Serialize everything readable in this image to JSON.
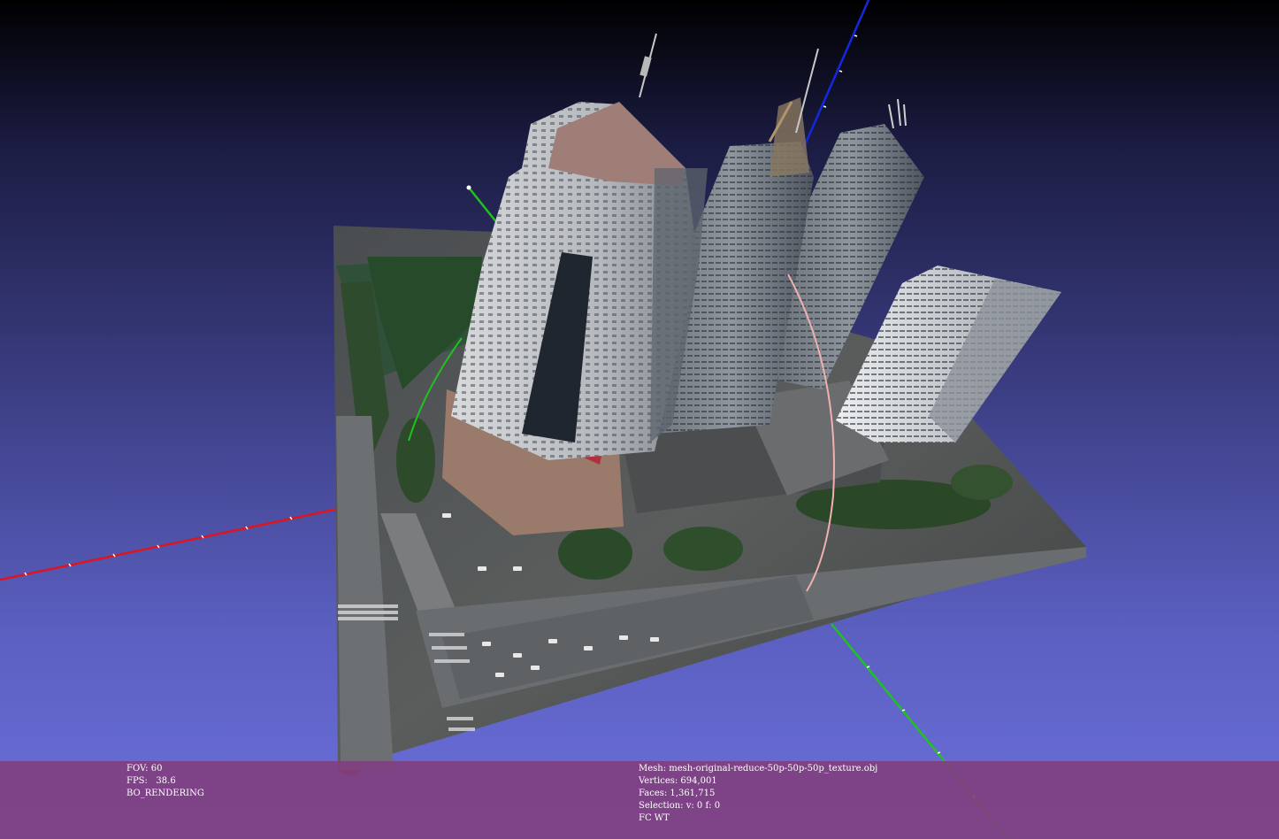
{
  "scene": {
    "background_top": "#000000",
    "background_bottom": "#6b70dc",
    "axis_x_color": "#e0141e",
    "axis_y_color": "#1fc21f",
    "axis_z_color": "#1428e0",
    "trackball_color": "#f0b0b0"
  },
  "info_left": {
    "fov": "FOV: 60",
    "fps": "FPS:   38.6",
    "mode": "BO_RENDERING"
  },
  "info_right": {
    "mesh": "Mesh: mesh-original-reduce-50p-50p-50p_texture.obj",
    "vertices": "Vertices: 694,001",
    "faces": "Faces: 1,361,715",
    "selection": "Selection: v: 0 f: 0",
    "fc": "FC WT"
  },
  "info_bar_color": "#804080"
}
